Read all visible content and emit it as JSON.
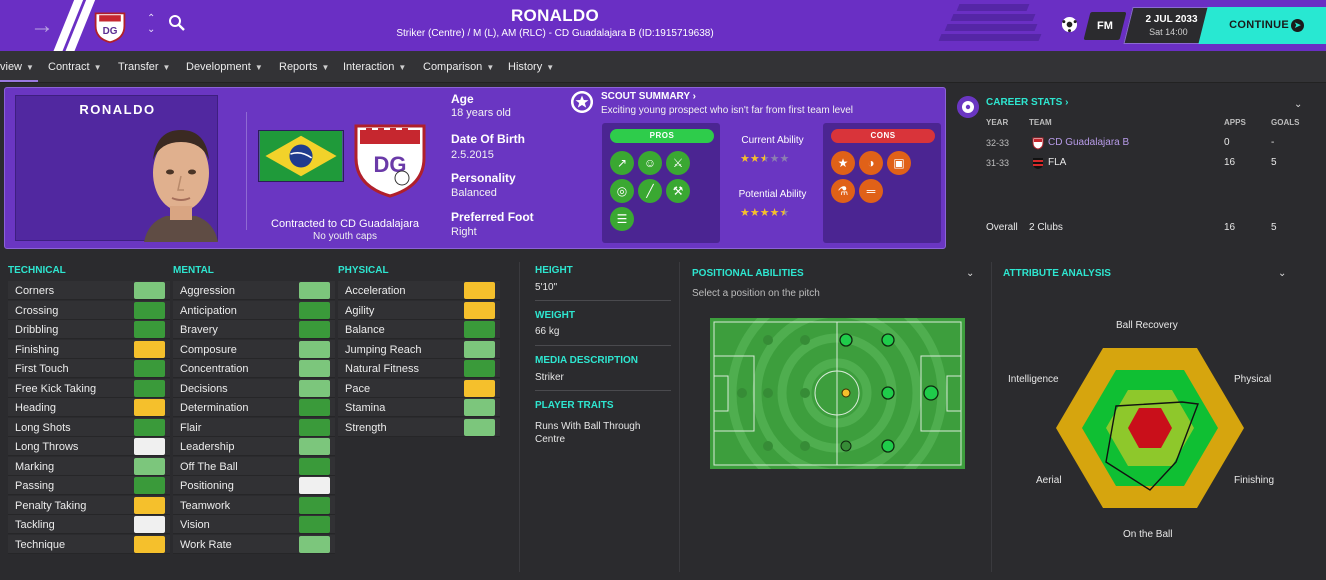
{
  "header": {
    "player_name": "RONALDO",
    "subtitle": "Striker (Centre) / M (L), AM (RLC) - CD Guadalajara B (ID:1915719638)",
    "fm_label": "FM",
    "date": "2 JUL 2033",
    "day_time": "Sat 14:00",
    "continue_label": "CONTINUE"
  },
  "nav": {
    "items": [
      "view",
      "Contract",
      "Transfer",
      "Development",
      "Reports",
      "Interaction",
      "Comparison",
      "History"
    ]
  },
  "profile": {
    "photo_name": "RONALDO",
    "contracted": "Contracted to CD Guadalajara",
    "youth_caps": "No youth caps",
    "age_label": "Age",
    "age_value": "18 years old",
    "dob_label": "Date Of Birth",
    "dob_value": "2.5.2015",
    "personality_label": "Personality",
    "personality_value": "Balanced",
    "foot_label": "Preferred Foot",
    "foot_value": "Right"
  },
  "scout": {
    "title": "SCOUT SUMMARY",
    "summary": "Exciting young prospect who isn't far from first team level",
    "pros_label": "PROS",
    "cons_label": "CONS",
    "current_ability_label": "Current Ability",
    "current_ability_stars": 2.5,
    "potential_ability_label": "Potential Ability",
    "potential_ability_stars": 4.5,
    "pros_icons": [
      "trend-up-icon",
      "head-icon",
      "feet-icon",
      "globe-icon",
      "bandage-icon",
      "wrench-icon",
      "contract-icon"
    ],
    "cons_icons": [
      "star-icon",
      "basketball-icon",
      "boots-icon",
      "flask-icon",
      "dumbbell-icon"
    ]
  },
  "career": {
    "title": "CAREER STATS",
    "headers": {
      "year": "YEAR",
      "team": "TEAM",
      "apps": "APPS",
      "goals": "GOALS"
    },
    "rows": [
      {
        "year": "32-33",
        "team": "CD Guadalajara B",
        "apps": "0",
        "goals": "-"
      },
      {
        "year": "31-33",
        "team": "FLA",
        "apps": "16",
        "goals": "5"
      }
    ],
    "overall_label": "Overall",
    "overall_clubs": "2 Clubs",
    "overall_apps": "16",
    "overall_goals": "5"
  },
  "attributes": {
    "technical_title": "TECHNICAL",
    "mental_title": "MENTAL",
    "physical_title": "PHYSICAL",
    "technical": [
      {
        "name": "Corners",
        "level": "good"
      },
      {
        "name": "Crossing",
        "level": "strong"
      },
      {
        "name": "Dribbling",
        "level": "strong"
      },
      {
        "name": "Finishing",
        "level": "average"
      },
      {
        "name": "First Touch",
        "level": "strong"
      },
      {
        "name": "Free Kick Taking",
        "level": "strong"
      },
      {
        "name": "Heading",
        "level": "average"
      },
      {
        "name": "Long Shots",
        "level": "strong"
      },
      {
        "name": "Long Throws",
        "level": "weak"
      },
      {
        "name": "Marking",
        "level": "good"
      },
      {
        "name": "Passing",
        "level": "strong"
      },
      {
        "name": "Penalty Taking",
        "level": "average"
      },
      {
        "name": "Tackling",
        "level": "weak"
      },
      {
        "name": "Technique",
        "level": "average"
      }
    ],
    "mental": [
      {
        "name": "Aggression",
        "level": "good"
      },
      {
        "name": "Anticipation",
        "level": "strong"
      },
      {
        "name": "Bravery",
        "level": "strong"
      },
      {
        "name": "Composure",
        "level": "good"
      },
      {
        "name": "Concentration",
        "level": "good"
      },
      {
        "name": "Decisions",
        "level": "good"
      },
      {
        "name": "Determination",
        "level": "strong"
      },
      {
        "name": "Flair",
        "level": "strong"
      },
      {
        "name": "Leadership",
        "level": "good"
      },
      {
        "name": "Off The Ball",
        "level": "strong"
      },
      {
        "name": "Positioning",
        "level": "weak"
      },
      {
        "name": "Teamwork",
        "level": "strong"
      },
      {
        "name": "Vision",
        "level": "strong"
      },
      {
        "name": "Work Rate",
        "level": "good"
      }
    ],
    "physical": [
      {
        "name": "Acceleration",
        "level": "average"
      },
      {
        "name": "Agility",
        "level": "average"
      },
      {
        "name": "Balance",
        "level": "strong"
      },
      {
        "name": "Jumping Reach",
        "level": "good"
      },
      {
        "name": "Natural Fitness",
        "level": "strong"
      },
      {
        "name": "Pace",
        "level": "average"
      },
      {
        "name": "Stamina",
        "level": "good"
      },
      {
        "name": "Strength",
        "level": "good"
      }
    ],
    "level_colors": {
      "strong": "#3a9a3a",
      "good": "#7cc67c",
      "average": "#f5c02c",
      "weak": "#f0f0f0"
    }
  },
  "details": {
    "height_label": "HEIGHT",
    "height_value": "5'10\"",
    "weight_label": "WEIGHT",
    "weight_value": "66 kg",
    "media_label": "MEDIA DESCRIPTION",
    "media_value": "Striker",
    "traits_label": "PLAYER TRAITS",
    "traits_value": "Runs With Ball Through Centre"
  },
  "positional": {
    "title": "POSITIONAL ABILITIES",
    "subtitle": "Select a position on the pitch"
  },
  "analysis": {
    "title": "ATTRIBUTE ANALYSIS",
    "labels": {
      "top": "Ball Recovery",
      "top_right": "Physical",
      "bottom_right": "Finishing",
      "bottom": "On the Ball",
      "bottom_left": "Aerial",
      "top_left": "Intelligence"
    }
  },
  "colors": {
    "accent_purple": "#6a2fc4",
    "teal": "#2ee6d0",
    "continue_bg": "#28e8d2",
    "pros_green": "#2ecc4b",
    "cons_red": "#d9343a"
  }
}
